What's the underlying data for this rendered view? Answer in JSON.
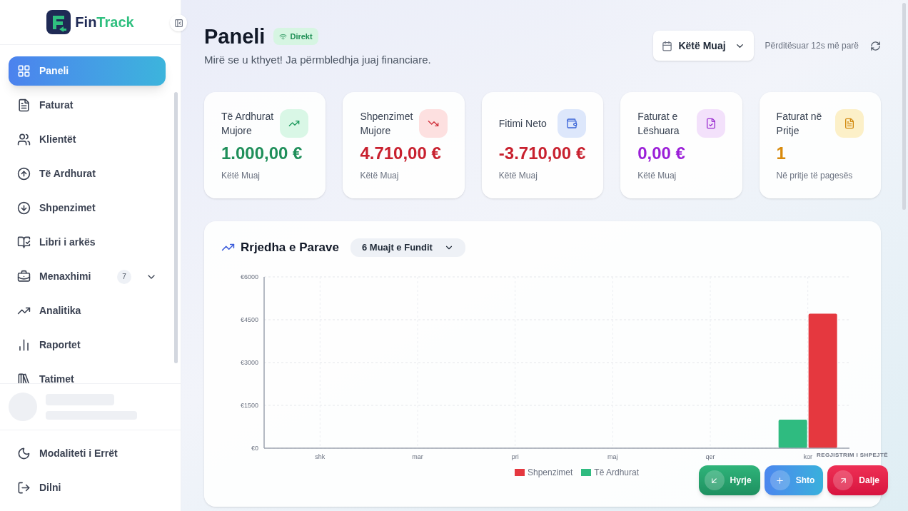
{
  "brand": {
    "name_part1": "Fin",
    "name_part2": "Track"
  },
  "sidebar": {
    "items": [
      {
        "label": "Paneli",
        "selected": true
      },
      {
        "label": "Faturat",
        "selected": false
      },
      {
        "label": "Klientët",
        "selected": false
      },
      {
        "label": "Të Ardhurat",
        "selected": false
      },
      {
        "label": "Shpenzimet",
        "selected": false
      },
      {
        "label": "Libri i arkës",
        "selected": false
      },
      {
        "label": "Menaxhimi",
        "selected": false,
        "badge": "7",
        "expanded": false
      },
      {
        "label": "Analitika",
        "selected": false
      },
      {
        "label": "Raportet",
        "selected": false
      },
      {
        "label": "Tatimet",
        "selected": false
      }
    ],
    "footer": [
      {
        "label": "Modaliteti i Errët"
      },
      {
        "label": "Dilni"
      }
    ]
  },
  "header": {
    "title": "Paneli",
    "live_badge": "Direkt",
    "subtitle": "Mirë se u kthyet! Ja përmbledhja juaj financiare.",
    "period": "Këtë Muaj",
    "updated": "Përditësuar 12s më parë"
  },
  "cards": [
    {
      "title": "Të Ardhurat Mujore",
      "value": "1.000,00 €",
      "note": "Këtë Muaj"
    },
    {
      "title": "Shpenzimet Mujore",
      "value": "4.710,00 €",
      "note": "Këtë Muaj"
    },
    {
      "title": "Fitimi Neto",
      "value": "-3.710,00 €",
      "note": "Këtë Muaj"
    },
    {
      "title": "Faturat e Lëshuara",
      "value": "0,00 €",
      "note": "Këtë Muaj"
    },
    {
      "title": "Faturat në Pritje",
      "value": "1",
      "note": "Në pritje të pagesës"
    }
  ],
  "cashflow": {
    "title": "Rrjedha e Parave",
    "range": "6 Muajt e Fundit",
    "chart_data": {
      "type": "bar",
      "grid": true,
      "legend": "bottom",
      "categories": [
        "shk",
        "mar",
        "pri",
        "maj",
        "qer",
        "kor"
      ],
      "series": [
        {
          "name": "Të Ardhurat",
          "color": "#2fbb80",
          "values": [
            0,
            0,
            0,
            0,
            0,
            1000
          ]
        },
        {
          "name": "Shpenzimet",
          "color": "#e5383f",
          "values": [
            0,
            0,
            0,
            0,
            0,
            4710
          ]
        }
      ],
      "ylim": [
        0,
        6000
      ],
      "yticks": [
        {
          "value": 0,
          "label": "€0"
        },
        {
          "value": 1500,
          "label": "€1500"
        },
        {
          "value": 3000,
          "label": "€3000"
        },
        {
          "value": 4500,
          "label": "€4500"
        },
        {
          "value": 6000,
          "label": "€6000"
        }
      ]
    }
  },
  "quick_entry": {
    "title": "REGJISTRIM I SHPEJTË",
    "buttons": [
      {
        "label": "Hyrje",
        "kind": "in"
      },
      {
        "label": "Shto",
        "kind": "add"
      },
      {
        "label": "Dalje",
        "kind": "out"
      }
    ]
  }
}
